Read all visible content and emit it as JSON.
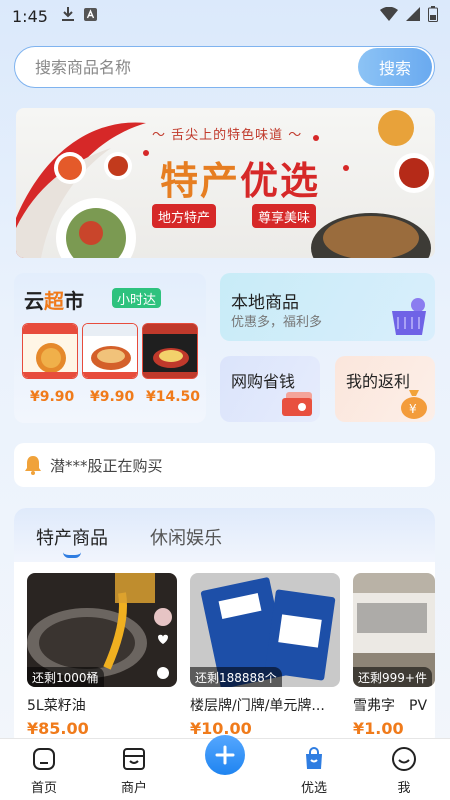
{
  "status_bar": {
    "time": "1:45"
  },
  "search": {
    "placeholder": "搜索商品名称",
    "button_label": "搜索"
  },
  "banner": {
    "subtitle": "舌尖上的特色味道",
    "title_part1": "特产",
    "title_part2": "优选",
    "tag_left": "地方特产",
    "tag_right": "尊享美味"
  },
  "supermarket": {
    "title_part1": "云",
    "title_part2": "超",
    "title_part3": "市",
    "badge": "小时达",
    "products": [
      {
        "price": "¥9.90"
      },
      {
        "price": "¥9.90"
      },
      {
        "price": "¥14.50"
      }
    ]
  },
  "local_goods": {
    "title": "本地商品",
    "subtitle": "优惠多，福利多"
  },
  "online_save": {
    "title": "网购省钱"
  },
  "my_rebate": {
    "title": "我的返利"
  },
  "notice": {
    "text": "潜***股正在购买"
  },
  "feed": {
    "tabs": [
      "特产商品",
      "休闲娱乐"
    ],
    "items": [
      {
        "stock": "还剩1000桶",
        "name": "5L菜籽油",
        "price": "¥85.00"
      },
      {
        "stock": "还剩188888个",
        "name": "楼层牌/门牌/单元牌...",
        "price": "¥10.00"
      },
      {
        "stock": "还剩999+件",
        "name": "雪弗字　PV",
        "price": "¥1.00"
      }
    ]
  },
  "tabbar": {
    "items": [
      "首页",
      "商户",
      "优选",
      "我"
    ]
  },
  "colors": {
    "accent": "#2f7de1",
    "price": "#f07b1b",
    "banner_red": "#d62828"
  }
}
